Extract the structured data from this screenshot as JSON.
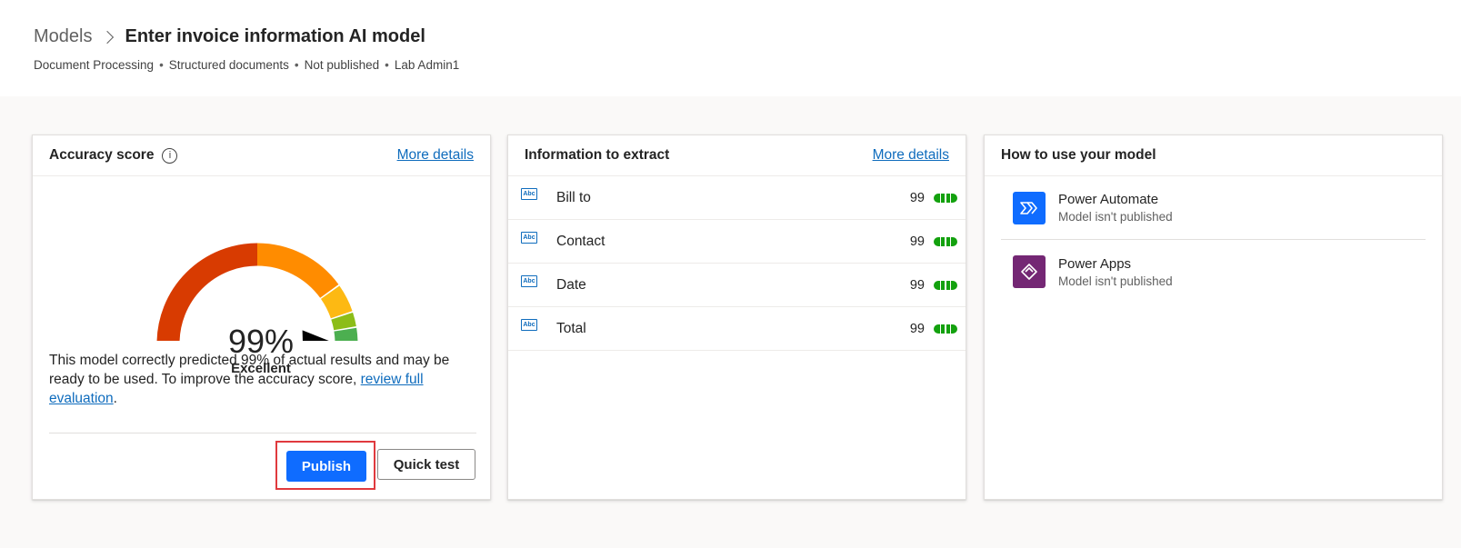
{
  "breadcrumb": {
    "parent": "Models",
    "current": "Enter invoice information AI model"
  },
  "meta": [
    "Document Processing",
    "Structured documents",
    "Not published",
    "Lab Admin1"
  ],
  "accuracy": {
    "title": "Accuracy score",
    "more_details": "More details",
    "score_text": "99%",
    "score_fraction": 0.99,
    "rating": "Excellent",
    "description_before": "This model correctly predicted 99% of actual results and may be ready to be used. To improve the accuracy score, ",
    "description_link": "review full evaluation",
    "description_after": ".",
    "publish_label": "Publish",
    "quick_test_label": "Quick test",
    "gauge_colors": [
      "#d83b01",
      "#ff8c00",
      "#fdb913",
      "#8cbd18",
      "#4caf50"
    ]
  },
  "extract": {
    "title": "Information to extract",
    "more_details": "More details",
    "icon_text": "Abc",
    "rows": [
      {
        "label": "Bill to",
        "score": "99"
      },
      {
        "label": "Contact",
        "score": "99"
      },
      {
        "label": "Date",
        "score": "99"
      },
      {
        "label": "Total",
        "score": "99"
      }
    ]
  },
  "usage": {
    "title": "How to use your model",
    "apps": [
      {
        "name": "Power Automate",
        "status": "Model isn't published",
        "icon": "power-automate-icon",
        "color": "#0f6cff"
      },
      {
        "name": "Power Apps",
        "status": "Model isn't published",
        "icon": "power-apps-icon",
        "color": "#742774"
      }
    ]
  }
}
